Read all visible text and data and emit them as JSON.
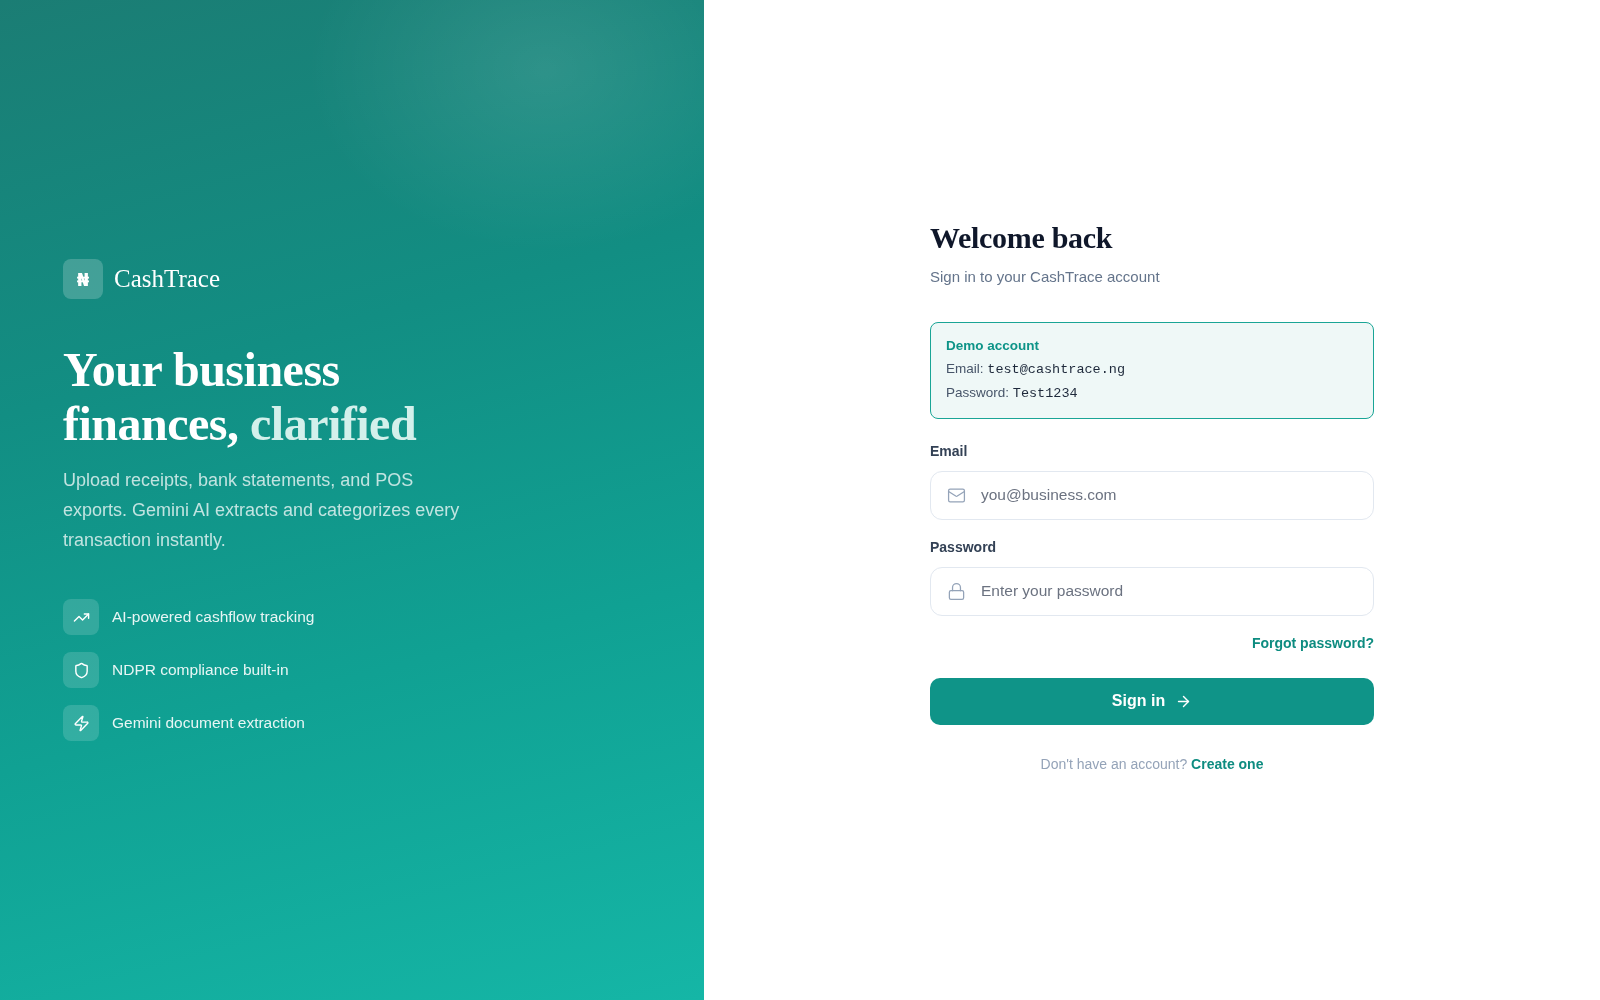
{
  "brand": {
    "logo_glyph": "₦",
    "name": "CashTrace"
  },
  "hero": {
    "title": "Your business finances,",
    "title_accent": "clarified",
    "description": "Upload receipts, bank statements, and POS exports. Gemini AI extracts and categorizes every transaction instantly."
  },
  "features": [
    {
      "label": "AI-powered cashflow tracking"
    },
    {
      "label": "NDPR compliance built-in"
    },
    {
      "label": "Gemini document extraction"
    }
  ],
  "form": {
    "title": "Welcome back",
    "subtitle": "Sign in to your CashTrace account",
    "demo": {
      "title": "Demo account",
      "lines": [
        {
          "label": "Email:",
          "value": "test@cashtrace.ng"
        },
        {
          "label": "Password:",
          "value": "Test1234"
        }
      ]
    },
    "fields": [
      {
        "kind": "email",
        "label": "Email",
        "placeholder": "you@business.com"
      },
      {
        "kind": "password",
        "label": "Password",
        "placeholder": "Enter your password"
      }
    ],
    "forgot_link": "Forgot password?",
    "submit": "Sign in",
    "footer": {
      "text": "Don't have an account?",
      "link": "Create one"
    }
  }
}
